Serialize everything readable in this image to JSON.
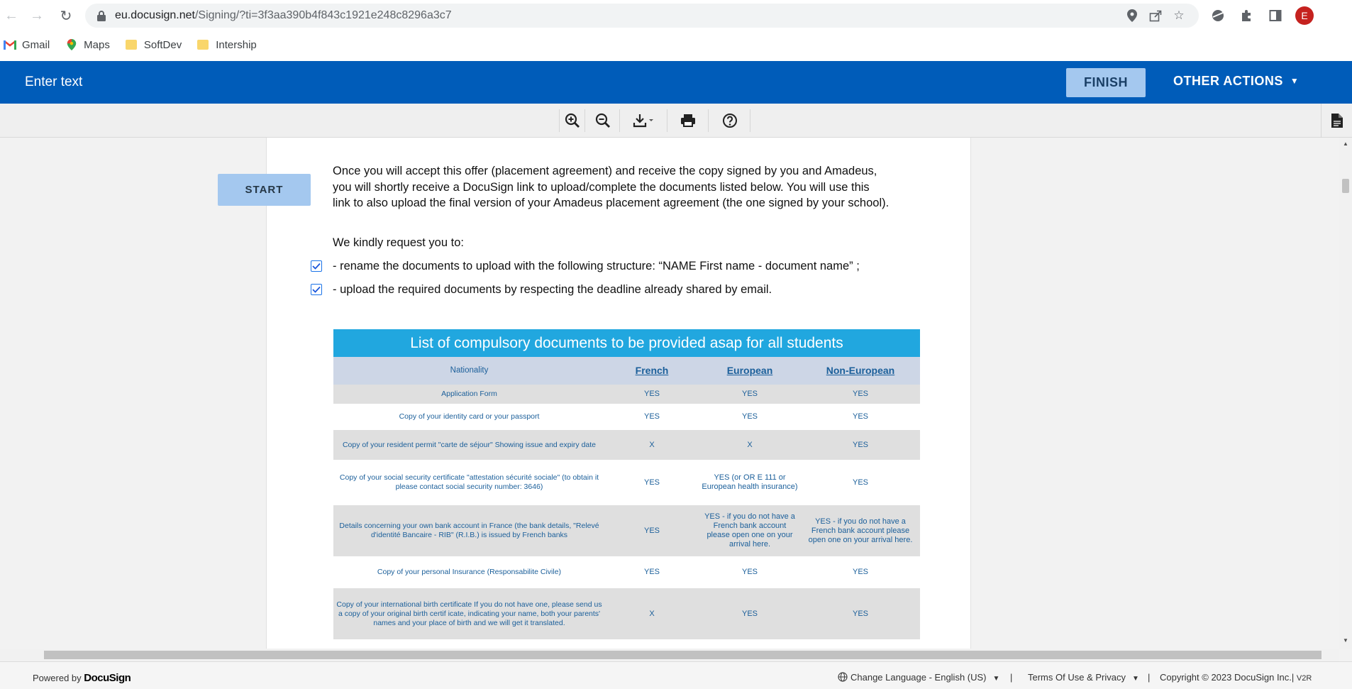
{
  "browser": {
    "url_host": "eu.docusign.net",
    "url_path": "/Signing/?ti=3f3aa390b4f843c1921e248c8296a3c7",
    "profile_initial": "E",
    "bookmarks": [
      {
        "label": "Gmail"
      },
      {
        "label": "Maps"
      },
      {
        "label": "SoftDev"
      },
      {
        "label": "Intership"
      }
    ]
  },
  "header": {
    "title": "Enter text",
    "finish_label": "FINISH",
    "other_actions_label": "OTHER ACTIONS",
    "brand_color": "#005cb9"
  },
  "toolbar": {
    "icons": [
      "zoom-in-icon",
      "zoom-out-icon",
      "download-icon",
      "print-icon",
      "help-icon",
      "document-icon"
    ]
  },
  "document": {
    "start_label": "START",
    "intro_lines": [
      "Once you will accept this offer (placement agreement) and receive the copy signed by you and Amadeus,",
      "you will shortly receive a DocuSign link to upload/complete the documents listed below. You will use this",
      "link to also upload the final version of your Amadeus placement agreement (the one signed by your school)."
    ],
    "request_heading": "We kindly request you to:",
    "checklist": [
      {
        "text": "- rename the documents to upload with the following structure: “NAME First name - document name” ;",
        "checked": true
      },
      {
        "text": "- upload the required documents by respecting the deadline already shared by email.",
        "checked": true
      }
    ],
    "table": {
      "title": "List of compulsory documents to be provided asap for all students",
      "headers": [
        "Nationality",
        "French",
        "European",
        "Non-European"
      ],
      "rows": [
        {
          "doc": "Application Form",
          "french": "YES",
          "european": "YES",
          "non_european": "YES"
        },
        {
          "doc": "Copy of your identity card or your passport",
          "french": "YES",
          "european": "YES",
          "non_european": "YES"
        },
        {
          "doc": "Copy of your resident permit \"carte de séjour\" Showing issue and expiry date",
          "french": "X",
          "european": "X",
          "non_european": "YES"
        },
        {
          "doc": "Copy of your social security certificate \"attestation sécurité sociale\" (to obtain it please contact social security number: 3646)",
          "french": "YES",
          "european": "YES (or OR E 111 or European health insurance)",
          "non_european": "YES"
        },
        {
          "doc": "Details concerning your own bank account in France (the bank details, \"Relevé d'identité Bancaire - RIB\" (R.I.B.) is issued by French banks",
          "french": "YES",
          "european": "YES - if you do not have a French bank account please open one on your arrival here.",
          "non_european": "YES - if you do not have a French bank account please open one on your arrival here."
        },
        {
          "doc": "Copy of your personal Insurance (Responsabilite Civile)",
          "french": "YES",
          "european": "YES",
          "non_european": "YES"
        },
        {
          "doc": "Copy of your international birth certificate If you do not have one, please send us a copy of your original birth certif icate, indicating your name, both your parents' names and your place of birth and we will get it translated.",
          "french": "X",
          "european": "YES",
          "non_european": "YES"
        }
      ]
    }
  },
  "footer": {
    "powered_prefix": "Powered by",
    "powered_brand": "DocuSign",
    "language": "Change Language - English (US)",
    "terms": "Terms Of Use & Privacy",
    "copyright": "Copyright © 2023 DocuSign Inc.",
    "version": "V2R",
    "separator": "|"
  }
}
